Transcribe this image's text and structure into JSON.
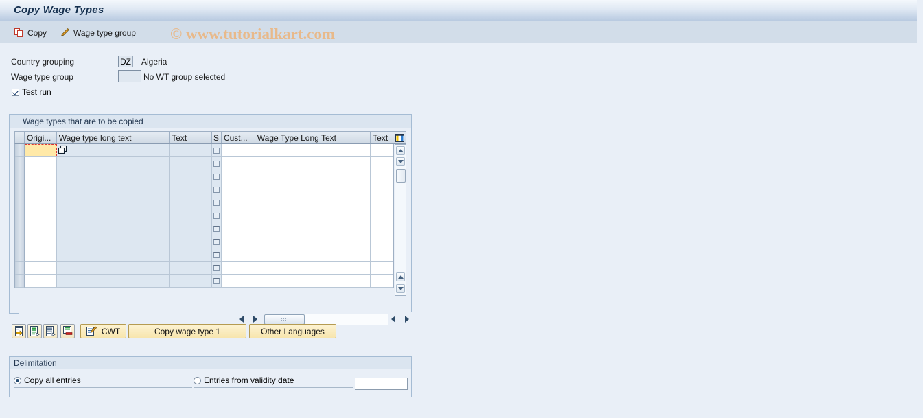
{
  "window": {
    "title": "Copy Wage Types"
  },
  "watermark": "© www.tutorialkart.com",
  "toolbar": {
    "copy_label": "Copy",
    "wage_type_group_label": "Wage type group"
  },
  "selection": {
    "country_grouping_label": "Country grouping",
    "country_grouping_value": "DZ",
    "country_grouping_desc": "Algeria",
    "wage_type_group_label": "Wage type group",
    "wage_type_group_value": "",
    "wage_type_group_desc": "No WT group selected",
    "test_run_label": "Test run",
    "test_run_checked": true
  },
  "table": {
    "caption": "Wage types that are to be copied",
    "columns": [
      {
        "key": "origin",
        "label": "Origi..."
      },
      {
        "key": "wtlong",
        "label": "Wage type long text"
      },
      {
        "key": "text1",
        "label": "Text"
      },
      {
        "key": "s",
        "label": "S"
      },
      {
        "key": "cust",
        "label": "Cust..."
      },
      {
        "key": "wtlong2",
        "label": "Wage Type Long Text"
      },
      {
        "key": "text2",
        "label": "Text"
      }
    ],
    "config_icon": "table-settings-icon",
    "row_count": 11,
    "rows": [
      {
        "origin": "",
        "wtlong": "",
        "text1": "",
        "s": "",
        "cust": "",
        "wtlong2": "",
        "text2": ""
      },
      {
        "origin": "",
        "wtlong": "",
        "text1": "",
        "s": "",
        "cust": "",
        "wtlong2": "",
        "text2": ""
      },
      {
        "origin": "",
        "wtlong": "",
        "text1": "",
        "s": "",
        "cust": "",
        "wtlong2": "",
        "text2": ""
      },
      {
        "origin": "",
        "wtlong": "",
        "text1": "",
        "s": "",
        "cust": "",
        "wtlong2": "",
        "text2": ""
      },
      {
        "origin": "",
        "wtlong": "",
        "text1": "",
        "s": "",
        "cust": "",
        "wtlong2": "",
        "text2": ""
      },
      {
        "origin": "",
        "wtlong": "",
        "text1": "",
        "s": "",
        "cust": "",
        "wtlong2": "",
        "text2": ""
      },
      {
        "origin": "",
        "wtlong": "",
        "text1": "",
        "s": "",
        "cust": "",
        "wtlong2": "",
        "text2": ""
      },
      {
        "origin": "",
        "wtlong": "",
        "text1": "",
        "s": "",
        "cust": "",
        "wtlong2": "",
        "text2": ""
      },
      {
        "origin": "",
        "wtlong": "",
        "text1": "",
        "s": "",
        "cust": "",
        "wtlong2": "",
        "text2": ""
      },
      {
        "origin": "",
        "wtlong": "",
        "text1": "",
        "s": "",
        "cust": "",
        "wtlong2": "",
        "text2": ""
      },
      {
        "origin": "",
        "wtlong": "",
        "text1": "",
        "s": "",
        "cust": "",
        "wtlong2": "",
        "text2": ""
      }
    ],
    "active_cell_value": ""
  },
  "buttons": {
    "icon_buttons": [
      {
        "name": "insert-row-icon-button"
      },
      {
        "name": "copy-row-icon-button"
      },
      {
        "name": "duplicate-row-icon-button"
      },
      {
        "name": "delete-row-icon-button"
      }
    ],
    "cwt_label": "CWT",
    "copy_wage_type_label": "Copy wage type 1",
    "other_languages_label": "Other Languages"
  },
  "delimitation": {
    "caption": "Delimitation",
    "copy_all_label": "Copy all entries",
    "copy_all_selected": true,
    "from_date_label": "Entries from validity date",
    "from_date_selected": false,
    "validity_date_value": ""
  },
  "colors": {
    "title_text": "#15304f",
    "watermark": "#e8b98a",
    "active_cell_bg": "#ffe9a8",
    "active_cell_border": "#dd3333",
    "button_bg": "#f7e5ad",
    "panel_bg": "#e9eff7"
  }
}
